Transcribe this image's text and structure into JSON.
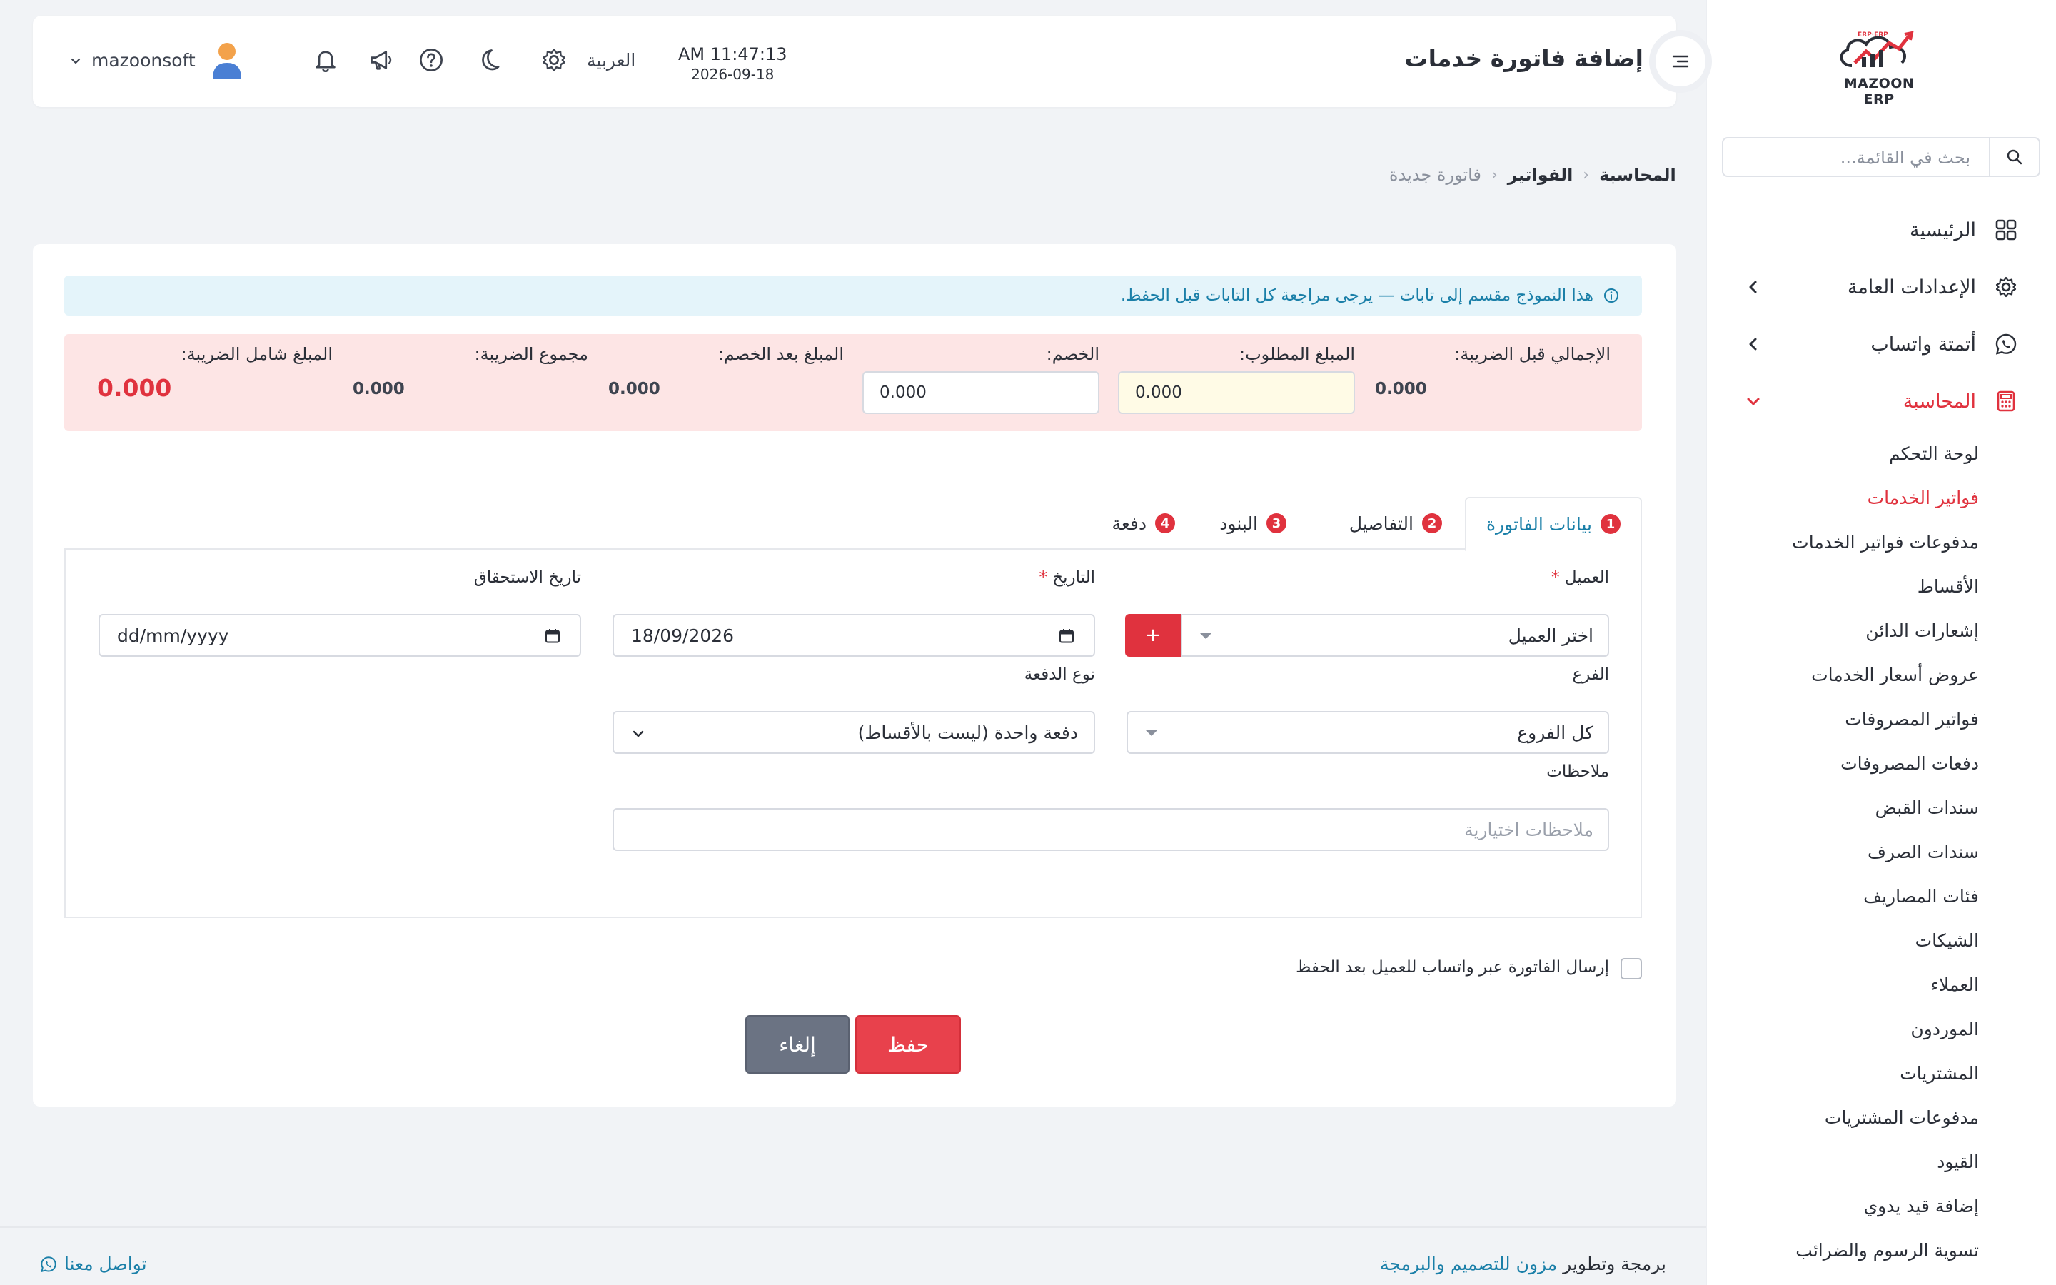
{
  "app": {
    "logo_text": "MAZOON ERP",
    "logo_small": "ERP·ERP",
    "brand_red": "#e0323e",
    "accent_blue": "#1a7fa8"
  },
  "sidebar": {
    "search_placeholder": "بحث في القائمة...",
    "items": [
      {
        "label": "الرئيسية",
        "icon": "grid-icon"
      },
      {
        "label": "الإعدادات العامة",
        "icon": "gear-icon"
      },
      {
        "label": "أتمتة واتساب",
        "icon": "whatsapp-icon"
      },
      {
        "label": "المحاسبة",
        "icon": "calculator-icon"
      }
    ],
    "submenu": [
      "لوحة التحكم",
      "فواتير الخدمات",
      "مدفوعات فواتير الخدمات",
      "الأقساط",
      "إشعارات الدائن",
      "عروض أسعار الخدمات",
      "فواتير المصروفات",
      "دفعات المصروفات",
      "سندات القبض",
      "سندات الصرف",
      "فئات المصاريف",
      "الشيكات",
      "العملاء",
      "الموردون",
      "المشتريات",
      "مدفوعات المشتريات",
      "القيود",
      "إضافة قيد يدوي",
      "تسوية الرسوم والضرائب"
    ],
    "active_submenu_index": 1
  },
  "header": {
    "title": "إضافة فاتورة خدمات",
    "time": "AM 11:47:13",
    "date": "2026-09-18",
    "language": "العربية",
    "username": "mazoonsoft"
  },
  "breadcrumb": {
    "items": [
      "المحاسبة",
      "الفواتير"
    ],
    "current": "فاتورة جديدة"
  },
  "notice": "هذا النموذج مقسم إلى تابات — يرجى مراجعة كل التابات قبل الحفظ.",
  "summary": {
    "subtotal_label": "الإجمالي قبل الضريبة:",
    "subtotal_value": "0.000",
    "amount_due_label": "المبلغ المطلوب:",
    "amount_due_value": "0.000",
    "discount_label": "الخصم:",
    "discount_value": "0.000",
    "after_discount_label": "المبلغ بعد الخصم:",
    "after_discount_value": "0.000",
    "tax_total_label": "مجموع الضريبة:",
    "tax_total_value": "0.000",
    "grand_total_label": "المبلغ شامل الضريبة:",
    "grand_total_value": "0.000"
  },
  "tabs": [
    {
      "num": "1",
      "label": "بيانات الفاتورة"
    },
    {
      "num": "2",
      "label": "التفاصيل"
    },
    {
      "num": "3",
      "label": "البنود"
    },
    {
      "num": "4",
      "label": "دفعة"
    }
  ],
  "form": {
    "customer_label": "العميل",
    "customer_value": "اختر العميل",
    "add_customer_label": "+",
    "date_label": "التاريخ",
    "date_value": "18/09/2026",
    "due_date_label": "تاريخ الاستحقاق",
    "due_date_value": "dd/mm/yyyy",
    "branch_label": "الفرع",
    "branch_value": "كل الفروع",
    "payment_type_label": "نوع الدفعة",
    "payment_type_value": "دفعة واحدة (ليست بالأقساط)",
    "notes_label": "ملاحظات",
    "notes_placeholder": "ملاحظات اختيارية",
    "required_mark": "*"
  },
  "whatsapp_checkbox_label": "إرسال الفاتورة عبر واتساب للعميل بعد الحفظ",
  "buttons": {
    "save": "حفظ",
    "cancel": "إلغاء"
  },
  "footer": {
    "credit_prefix": "برمجة وتطوير",
    "credit_link": "مزون للتصميم والبرمجة",
    "contact": "تواصل معنا"
  }
}
